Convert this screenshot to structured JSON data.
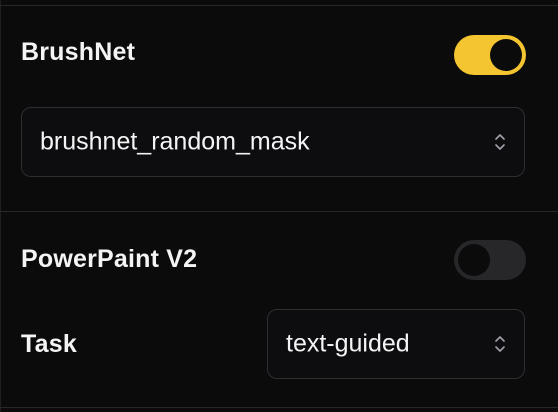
{
  "brushnet": {
    "label": "BrushNet",
    "enabled": true,
    "model_select": {
      "value": "brushnet_random_mask"
    }
  },
  "powerpaint": {
    "label": "PowerPaint V2",
    "enabled": false,
    "task_label": "Task",
    "task_select": {
      "value": "text-guided"
    }
  },
  "colors": {
    "accent": "#f5c531",
    "background": "#0b0b0c",
    "toggle_off": "#27272a",
    "border": "#2e2e33"
  },
  "icons": {
    "select_chevrons": "chevron-up-down-icon"
  }
}
